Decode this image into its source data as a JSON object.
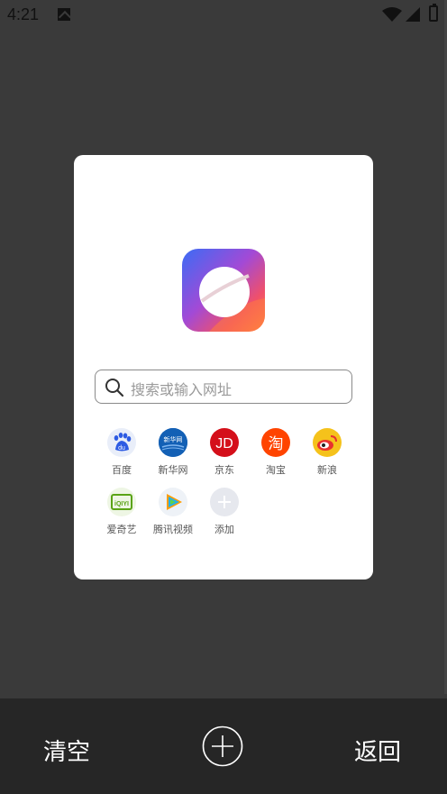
{
  "status_bar": {
    "time": "4:21"
  },
  "search": {
    "placeholder": "搜索或输入网址"
  },
  "shortcuts": [
    {
      "label": "百度",
      "icon": "baidu-icon"
    },
    {
      "label": "新华网",
      "icon": "xinhua-icon"
    },
    {
      "label": "京东",
      "icon": "jd-icon"
    },
    {
      "label": "淘宝",
      "icon": "taobao-icon"
    },
    {
      "label": "新浪",
      "icon": "sina-weibo-icon"
    },
    {
      "label": "爱奇艺",
      "icon": "iqiyi-icon"
    },
    {
      "label": "腾讯视频",
      "icon": "tencent-video-icon"
    },
    {
      "label": "添加",
      "icon": "add-shortcut-icon"
    }
  ],
  "icon_texts": {
    "baidu": "du",
    "xinhua": "新华网",
    "jd": "JD",
    "taobao": "淘",
    "iqiyi": "iQIYI"
  },
  "bottom_bar": {
    "clear_label": "清空",
    "back_label": "返回"
  },
  "colors": {
    "background": "#3a3a3a",
    "card": "#ffffff",
    "bottom_bar": "#262626",
    "jd_red": "#d40f1a",
    "taobao_orange": "#ff4400",
    "baidu_blue": "#2d5be3",
    "xinhua_blue": "#1360b5",
    "iqiyi_green": "#5aa315",
    "weibo_yellow": "#f5c21b"
  }
}
